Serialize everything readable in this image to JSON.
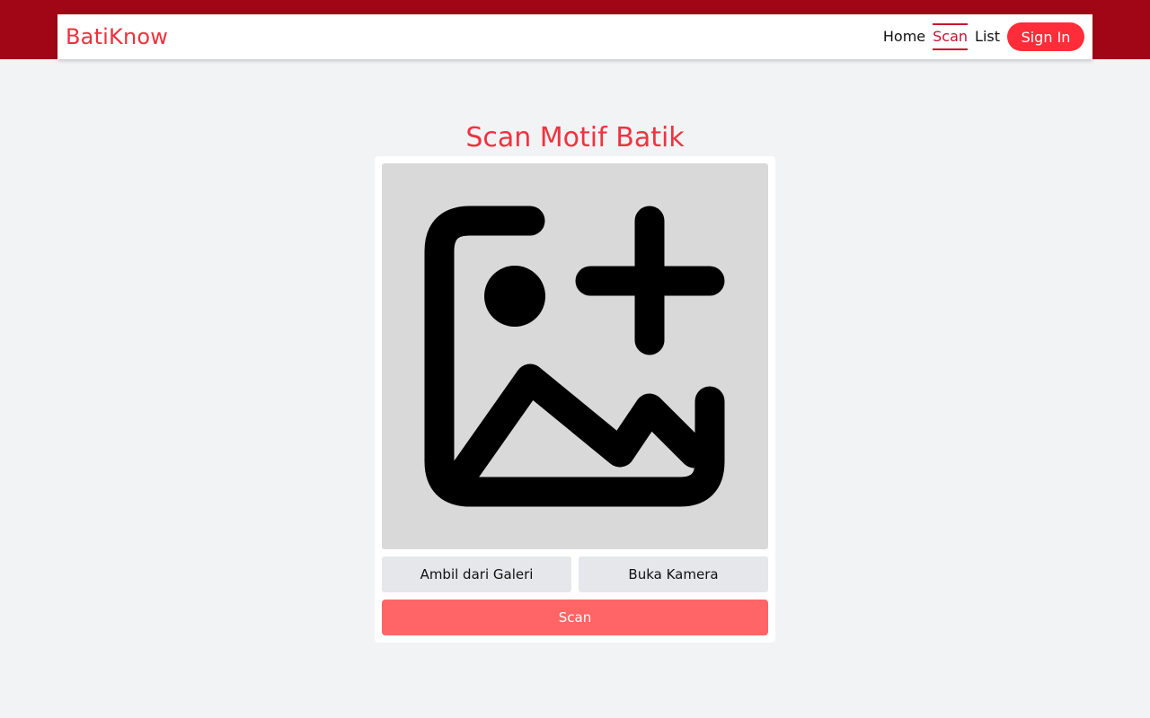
{
  "header": {
    "brand": "BatiKnow",
    "nav": [
      {
        "label": "Home",
        "active": false
      },
      {
        "label": "Scan",
        "active": true
      },
      {
        "label": "List",
        "active": false
      }
    ],
    "signin_label": "Sign In"
  },
  "main": {
    "title": "Scan Motif Batik",
    "preview_icon": "image-add-icon",
    "gallery_button": "Ambil dari Galeri",
    "camera_button": "Buka Kamera",
    "scan_button": "Scan"
  },
  "colors": {
    "header_band": "#a00616",
    "brand": "#f0303c",
    "active_nav": "#c8102e",
    "signin": "#ff2d3a",
    "scan_button": "#ff6566",
    "background": "#f2f3f5"
  }
}
